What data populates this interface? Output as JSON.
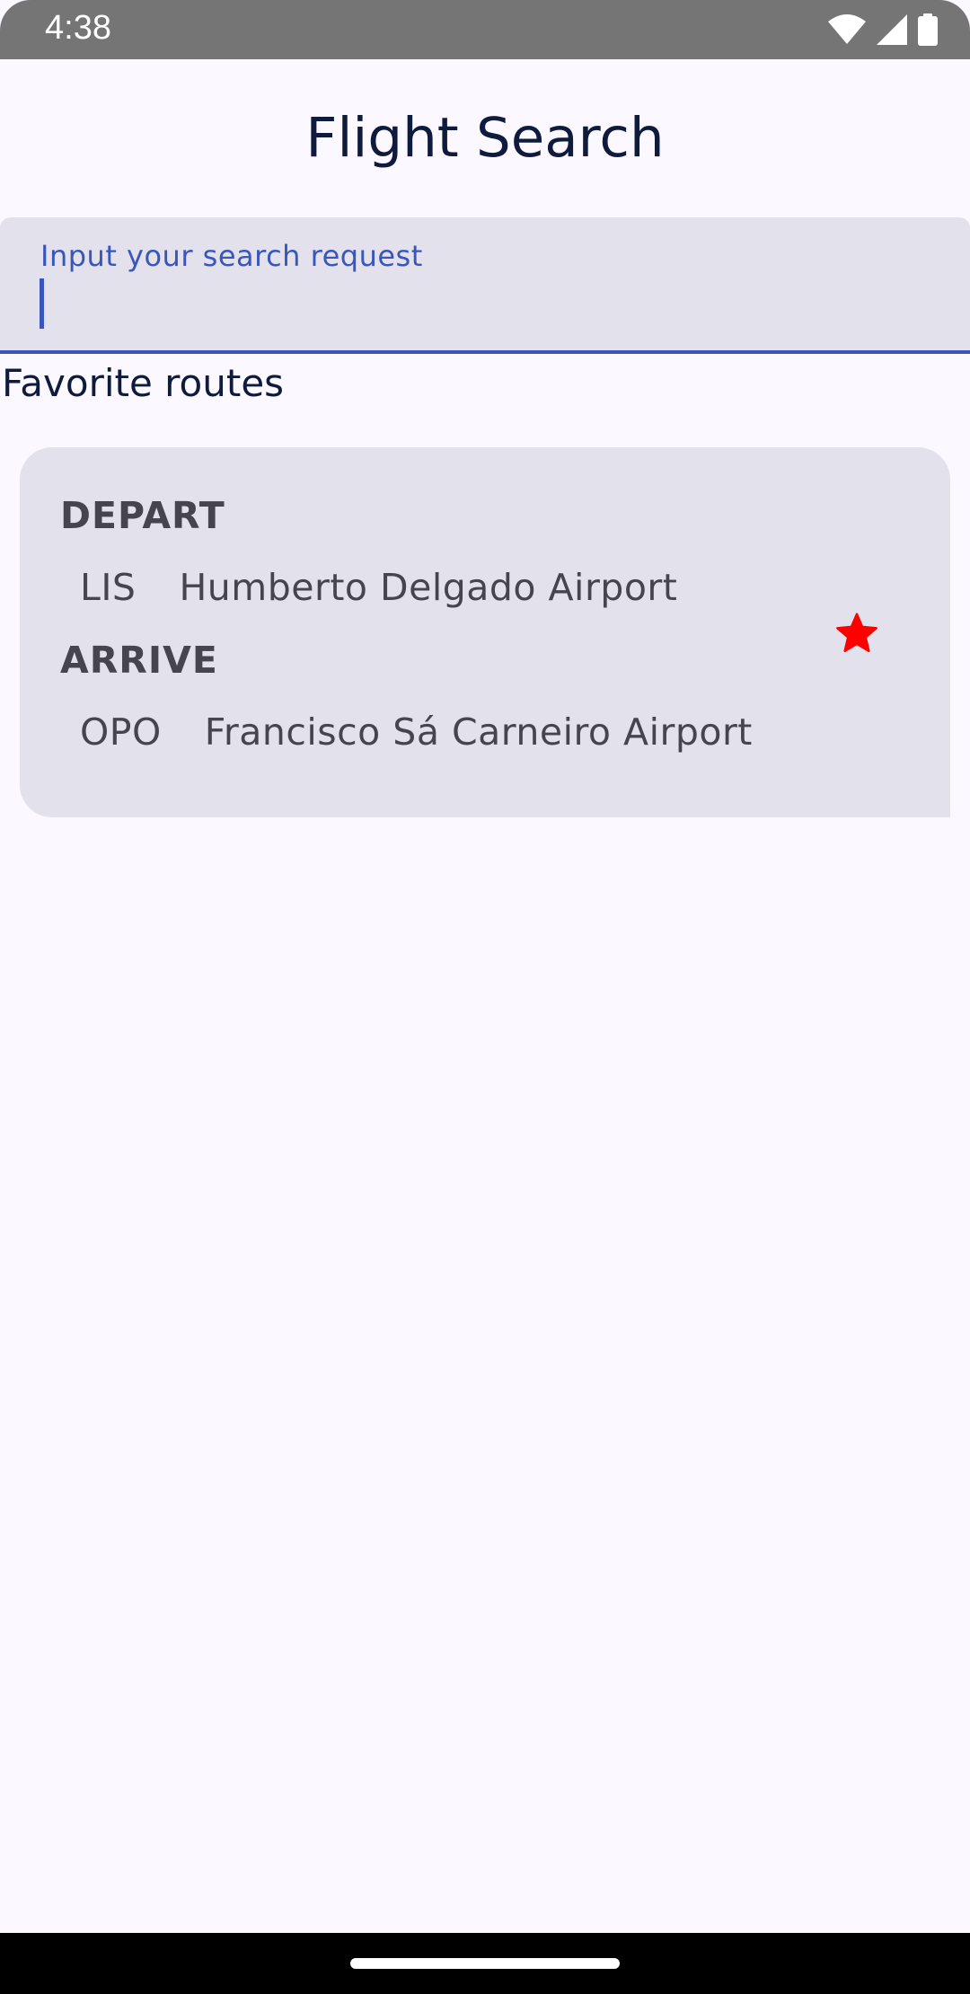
{
  "status_bar": {
    "time": "4:38",
    "icons": [
      "wifi-icon",
      "signal-icon",
      "battery-icon"
    ]
  },
  "app": {
    "title": "Flight Search"
  },
  "search": {
    "label": "Input your search request",
    "value": ""
  },
  "favorites": {
    "section_title": "Favorite routes",
    "routes": [
      {
        "depart_label": "DEPART",
        "depart_code": "LIS",
        "depart_name": "Humberto Delgado Airport",
        "arrive_label": "ARRIVE",
        "arrive_code": "OPO",
        "arrive_name": "Francisco Sá Carneiro Airport",
        "favorite_icon": "star-icon",
        "is_favorite": true
      }
    ]
  },
  "colors": {
    "accent": "#3a56bd",
    "favorite_star": "#ff0000",
    "card_background": "#e3e1ec",
    "page_background": "#fcf8ff"
  }
}
